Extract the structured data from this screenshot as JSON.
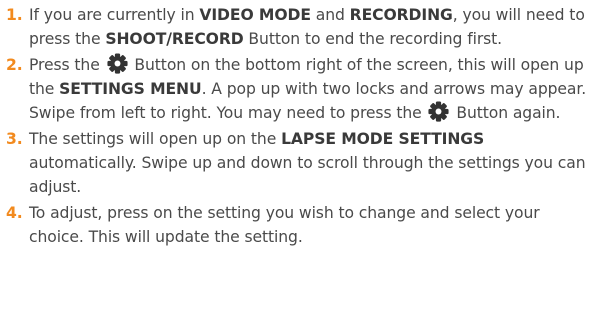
{
  "accent_color": "#f28a1e",
  "text_color": "#4a4a4a",
  "icon": "settings-gear-icon",
  "steps": [
    {
      "number": "1.",
      "t1": "If you are currently in ",
      "b1": "VIDEO MODE",
      "t2": " and ",
      "b2": "RECORDING",
      "t3": ", you will need to press the ",
      "b3": "SHOOT/RECORD",
      "t4": " Button to end the recording first."
    },
    {
      "number": "2.",
      "t1": "Press the ",
      "t2": " Button on the bottom right of the screen, this will open up the ",
      "b1": "SETTINGS MENU",
      "t3": ". A pop up with two locks and arrows may appear. Swipe from left to right. You may need to press the ",
      "t4": " Button again."
    },
    {
      "number": "3.",
      "t1": "The settings will open up on the ",
      "b1": "LAPSE MODE SETTINGS",
      "t2": " automatically. Swipe up and down to scroll through the settings you can adjust."
    },
    {
      "number": "4.",
      "t1": "To adjust, press on the setting you wish to change and select your choice. This will update the setting."
    }
  ]
}
